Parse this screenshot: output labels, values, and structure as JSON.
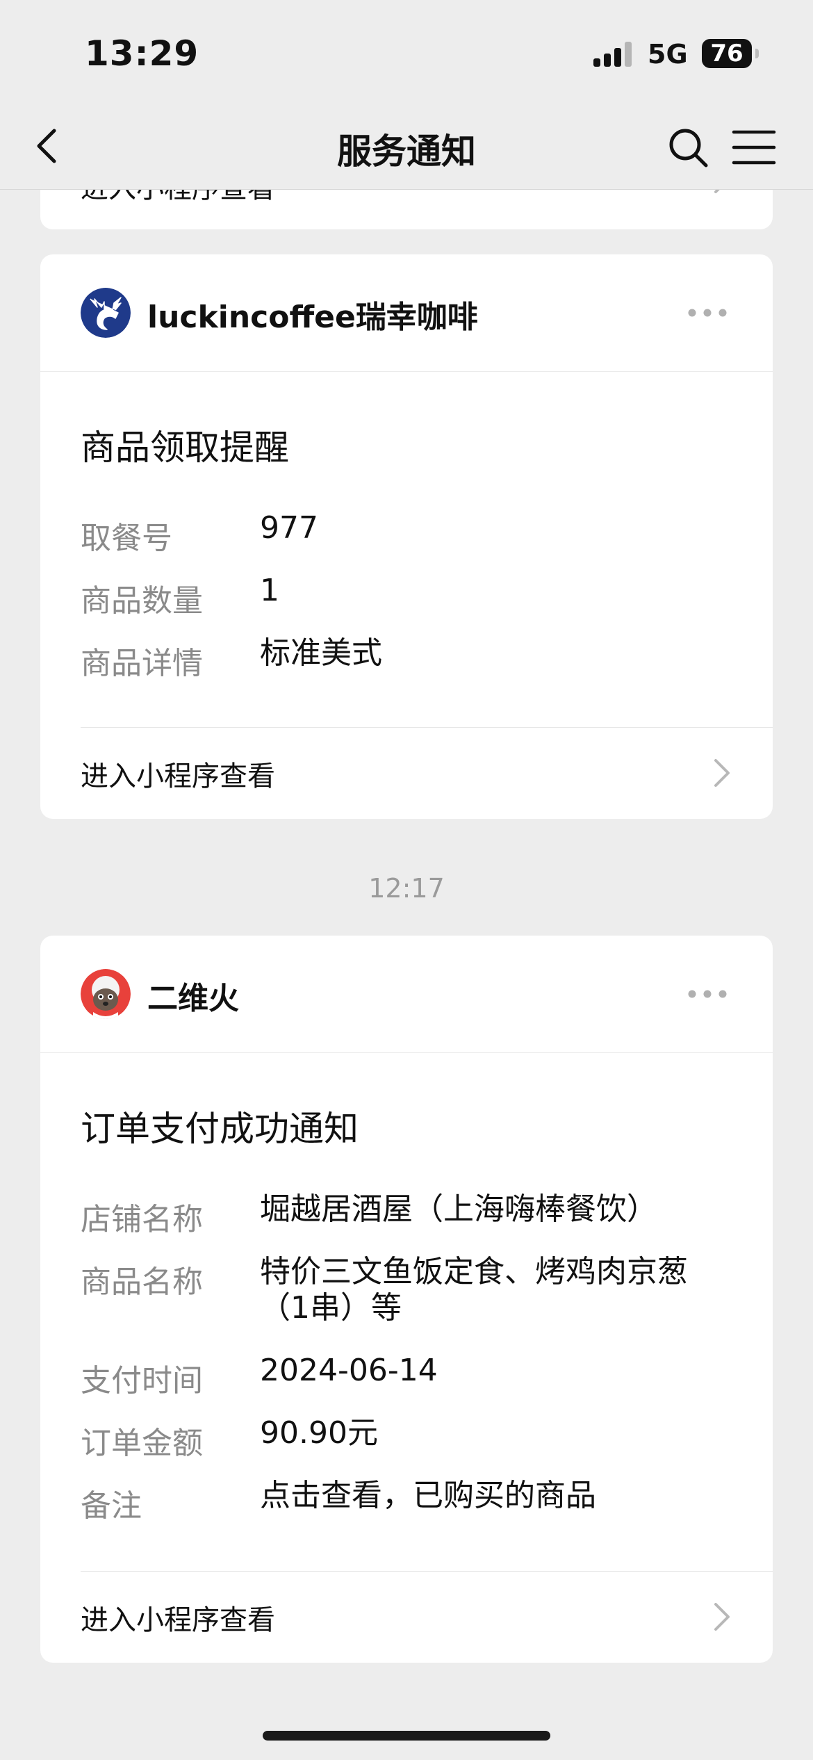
{
  "status_bar": {
    "time": "13:29",
    "network": "5G",
    "battery": "76",
    "signal_bars_active": 3,
    "signal_bars_total": 4
  },
  "nav": {
    "back_icon": "chevron-left-icon",
    "title": "服务通知",
    "search_icon": "search-icon",
    "menu_icon": "menu-icon"
  },
  "partial_card": {
    "link_label": "进入小程序查看"
  },
  "cards": [
    {
      "sender": "luckincoffee瑞幸咖啡",
      "avatar_icon": "luckin-deer-logo-icon",
      "avatar_color": "#1f3a8a",
      "title": "商品领取提醒",
      "rows": [
        {
          "label": "取餐号",
          "value": "977"
        },
        {
          "label": "商品数量",
          "value": "1"
        },
        {
          "label": "商品详情",
          "value": "标准美式"
        }
      ],
      "link_label": "进入小程序查看"
    },
    {
      "sender": "二维火",
      "avatar_icon": "fire-mascot-avatar-icon",
      "avatar_color": "#e8413b",
      "title": "订单支付成功通知",
      "rows": [
        {
          "label": "店铺名称",
          "value": "堀越居酒屋（上海嗨棒餐饮）"
        },
        {
          "label": "商品名称",
          "value": "特价三文鱼饭定食、烤鸡肉京葱（1串）等"
        },
        {
          "label": "支付时间",
          "value": "2024-06-14"
        },
        {
          "label": "订单金额",
          "value": "90.90元"
        },
        {
          "label": "备注",
          "value": "点击查看，已购买的商品"
        }
      ],
      "link_label": "进入小程序查看"
    }
  ],
  "timestamp": "12:17",
  "colors": {
    "background": "#ededed",
    "card": "#ffffff",
    "label_gray": "#8a8a8a",
    "text": "#111111"
  }
}
